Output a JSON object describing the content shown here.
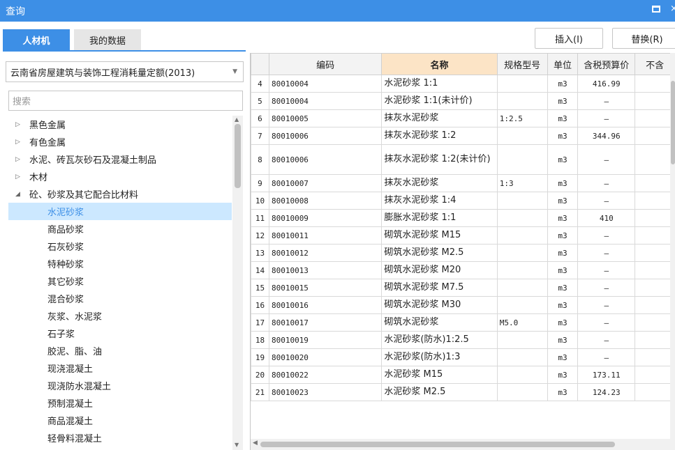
{
  "window": {
    "title": "查询",
    "close_glyph": "×"
  },
  "tabs": [
    {
      "label": "人材机"
    },
    {
      "label": "我的数据"
    }
  ],
  "toolbar": {
    "insert_label": "插入(I)",
    "replace_label": "替换(R)"
  },
  "quota_select": {
    "value": "云南省房屋建筑与装饰工程消耗量定额(2013)"
  },
  "search": {
    "placeholder": "搜索"
  },
  "tree": {
    "nodes": [
      {
        "label": "黑色金属",
        "level": 0,
        "expanded": false
      },
      {
        "label": "有色金属",
        "level": 0,
        "expanded": false
      },
      {
        "label": "水泥、砖瓦灰砂石及混凝土制品",
        "level": 0,
        "expanded": false
      },
      {
        "label": "木材",
        "level": 0,
        "expanded": false
      },
      {
        "label": "砼、砂浆及其它配合比材料",
        "level": 0,
        "expanded": true
      },
      {
        "label": "水泥砂浆",
        "level": 1,
        "selected": true
      },
      {
        "label": "商品砂浆",
        "level": 1
      },
      {
        "label": "石灰砂浆",
        "level": 1
      },
      {
        "label": "特种砂浆",
        "level": 1
      },
      {
        "label": "其它砂浆",
        "level": 1
      },
      {
        "label": "混合砂浆",
        "level": 1
      },
      {
        "label": "灰浆、水泥浆",
        "level": 1
      },
      {
        "label": "石子浆",
        "level": 1
      },
      {
        "label": "胶泥、脂、油",
        "level": 1
      },
      {
        "label": "现浇混凝土",
        "level": 1
      },
      {
        "label": "现浇防水混凝土",
        "level": 1
      },
      {
        "label": "预制混凝土",
        "level": 1
      },
      {
        "label": "商品混凝土",
        "level": 1
      },
      {
        "label": "轻骨料混凝土",
        "level": 1
      }
    ]
  },
  "table": {
    "columns": [
      "",
      "编码",
      "名称",
      "规格型号",
      "单位",
      "含税预算价",
      "不含"
    ],
    "rows": [
      {
        "idx": "4",
        "code": "80010004",
        "name": "水泥砂浆 1:1",
        "spec": "",
        "unit": "m3",
        "price": "416.99"
      },
      {
        "idx": "5",
        "code": "80010004",
        "name": "水泥砂浆 1:1(未计价)",
        "spec": "",
        "unit": "m3",
        "price": "—"
      },
      {
        "idx": "6",
        "code": "80010005",
        "name": "抹灰水泥砂浆",
        "spec": "1:2.5",
        "unit": "m3",
        "price": "—"
      },
      {
        "idx": "7",
        "code": "80010006",
        "name": "抹灰水泥砂浆 1:2",
        "spec": "",
        "unit": "m3",
        "price": "344.96"
      },
      {
        "idx": "8",
        "code": "80010006",
        "name": "抹灰水泥砂浆 1:2(未计价)",
        "spec": "",
        "unit": "m3",
        "price": "—"
      },
      {
        "idx": "9",
        "code": "80010007",
        "name": "抹灰水泥砂浆",
        "spec": "1:3",
        "unit": "m3",
        "price": "—"
      },
      {
        "idx": "10",
        "code": "80010008",
        "name": "抹灰水泥砂浆 1:4",
        "spec": "",
        "unit": "m3",
        "price": "—"
      },
      {
        "idx": "11",
        "code": "80010009",
        "name": "膨胀水泥砂浆 1:1",
        "spec": "",
        "unit": "m3",
        "price": "410"
      },
      {
        "idx": "12",
        "code": "80010011",
        "name": "砌筑水泥砂浆 M15",
        "spec": "",
        "unit": "m3",
        "price": "—"
      },
      {
        "idx": "13",
        "code": "80010012",
        "name": "砌筑水泥砂浆 M2.5",
        "spec": "",
        "unit": "m3",
        "price": "—"
      },
      {
        "idx": "14",
        "code": "80010013",
        "name": "砌筑水泥砂浆 M20",
        "spec": "",
        "unit": "m3",
        "price": "—"
      },
      {
        "idx": "15",
        "code": "80010015",
        "name": "砌筑水泥砂浆 M7.5",
        "spec": "",
        "unit": "m3",
        "price": "—"
      },
      {
        "idx": "16",
        "code": "80010016",
        "name": "砌筑水泥砂浆 M30",
        "spec": "",
        "unit": "m3",
        "price": "—"
      },
      {
        "idx": "17",
        "code": "80010017",
        "name": "砌筑水泥砂浆",
        "spec": "M5.0",
        "unit": "m3",
        "price": "—"
      },
      {
        "idx": "18",
        "code": "80010019",
        "name": "水泥砂浆(防水)1:2.5",
        "spec": "",
        "unit": "m3",
        "price": "—"
      },
      {
        "idx": "19",
        "code": "80010020",
        "name": "水泥砂浆(防水)1:3",
        "spec": "",
        "unit": "m3",
        "price": "—"
      },
      {
        "idx": "20",
        "code": "80010022",
        "name": "水泥砂浆 M15",
        "spec": "",
        "unit": "m3",
        "price": "173.11"
      },
      {
        "idx": "21",
        "code": "80010023",
        "name": "水泥砂浆 M2.5",
        "spec": "",
        "unit": "m3",
        "price": "124.23"
      }
    ]
  },
  "colors": {
    "accent": "#3d8fe6",
    "selected_bg": "#cce8ff",
    "sorted_header": "#fce4c6"
  },
  "icons": [
    "window-maximize-icon",
    "window-close-icon",
    "dropdown-caret-icon",
    "tree-collapsed-arrow-icon",
    "tree-expanded-arrow-icon",
    "scroll-up-icon",
    "scroll-down-icon",
    "scroll-left-icon",
    "scroll-right-icon"
  ]
}
